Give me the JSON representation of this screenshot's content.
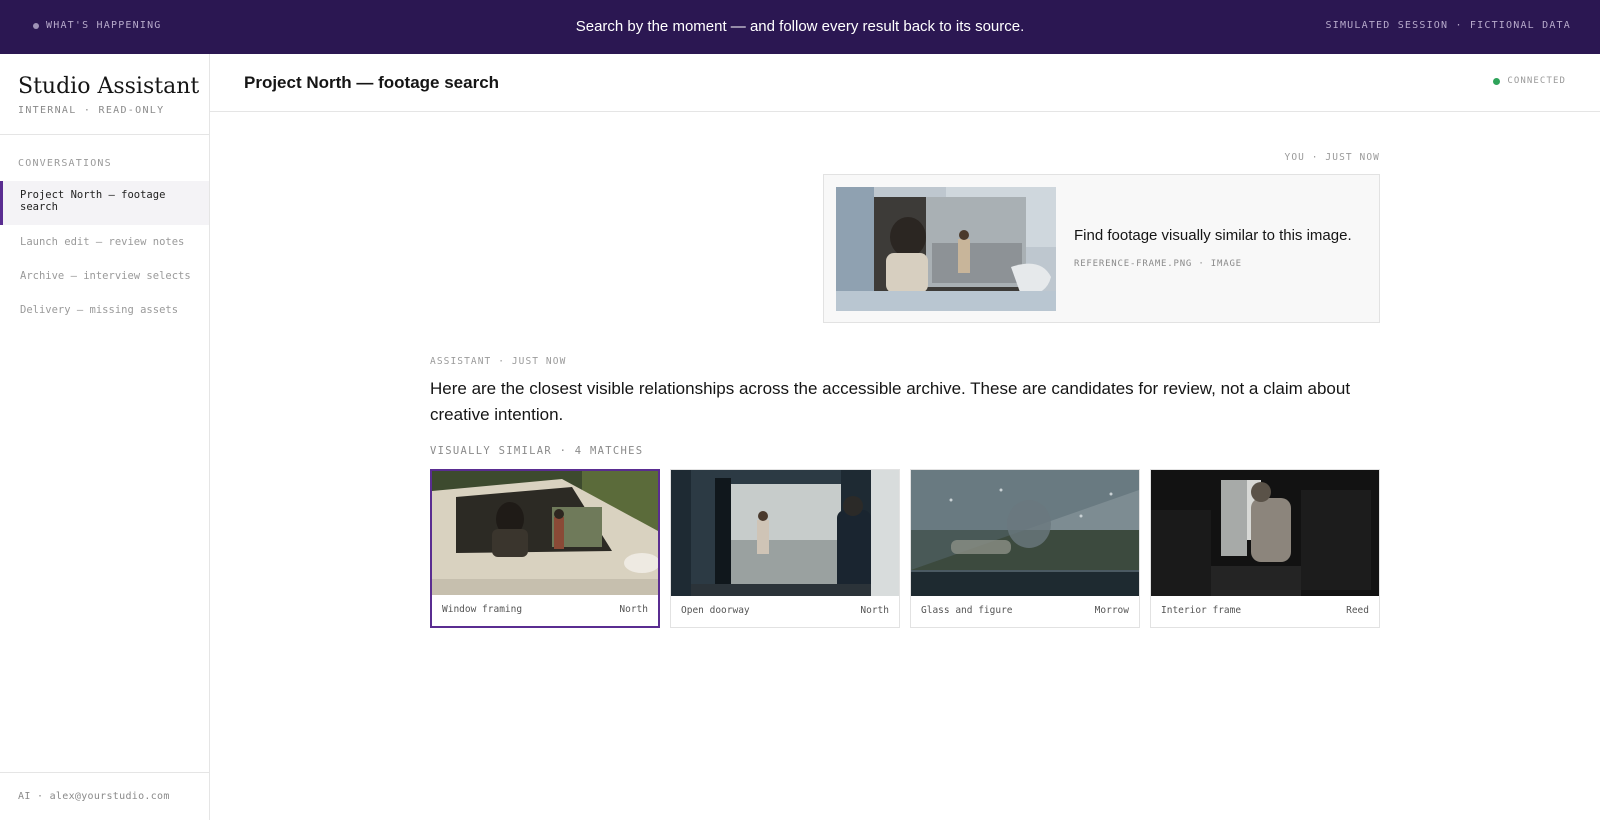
{
  "banner": {
    "left": "WHAT'S HAPPENING",
    "center": "Search by the moment — and follow every result back to its source.",
    "right": "SIMULATED SESSION · FICTIONAL DATA"
  },
  "sidebar": {
    "brand_title": "Studio Assistant",
    "brand_subtitle": "INTERNAL · READ-ONLY",
    "conversations_heading": "CONVERSATIONS",
    "conversations": [
      {
        "label": "Project North — footage search",
        "active": true
      },
      {
        "label": "Launch edit — review notes",
        "active": false
      },
      {
        "label": "Archive — interview selects",
        "active": false
      },
      {
        "label": "Delivery — missing assets",
        "active": false
      }
    ],
    "footer": "AI · alex@yourstudio.com"
  },
  "header": {
    "title": "Project North — footage search",
    "status": "CONNECTED",
    "status_color": "#2ea35a"
  },
  "user_message": {
    "meta": "YOU · JUST NOW",
    "text": "Find footage visually similar to this image.",
    "attachment": "REFERENCE-FRAME.PNG · IMAGE"
  },
  "assistant_message": {
    "meta": "ASSISTANT · JUST NOW",
    "text": "Here are the closest visible relationships across the accessible archive. These are candidates for review, not a claim about creative intention.",
    "section_heading": "VISUALLY SIMILAR · 4 MATCHES",
    "results": [
      {
        "label": "Window framing",
        "project": "North",
        "selected": true
      },
      {
        "label": "Open doorway",
        "project": "North",
        "selected": false
      },
      {
        "label": "Glass and figure",
        "project": "Morrow",
        "selected": false
      },
      {
        "label": "Interior frame",
        "project": "Reed",
        "selected": false
      }
    ]
  },
  "colors": {
    "banner_bg": "#2b1752",
    "accent": "#5a2d91"
  }
}
